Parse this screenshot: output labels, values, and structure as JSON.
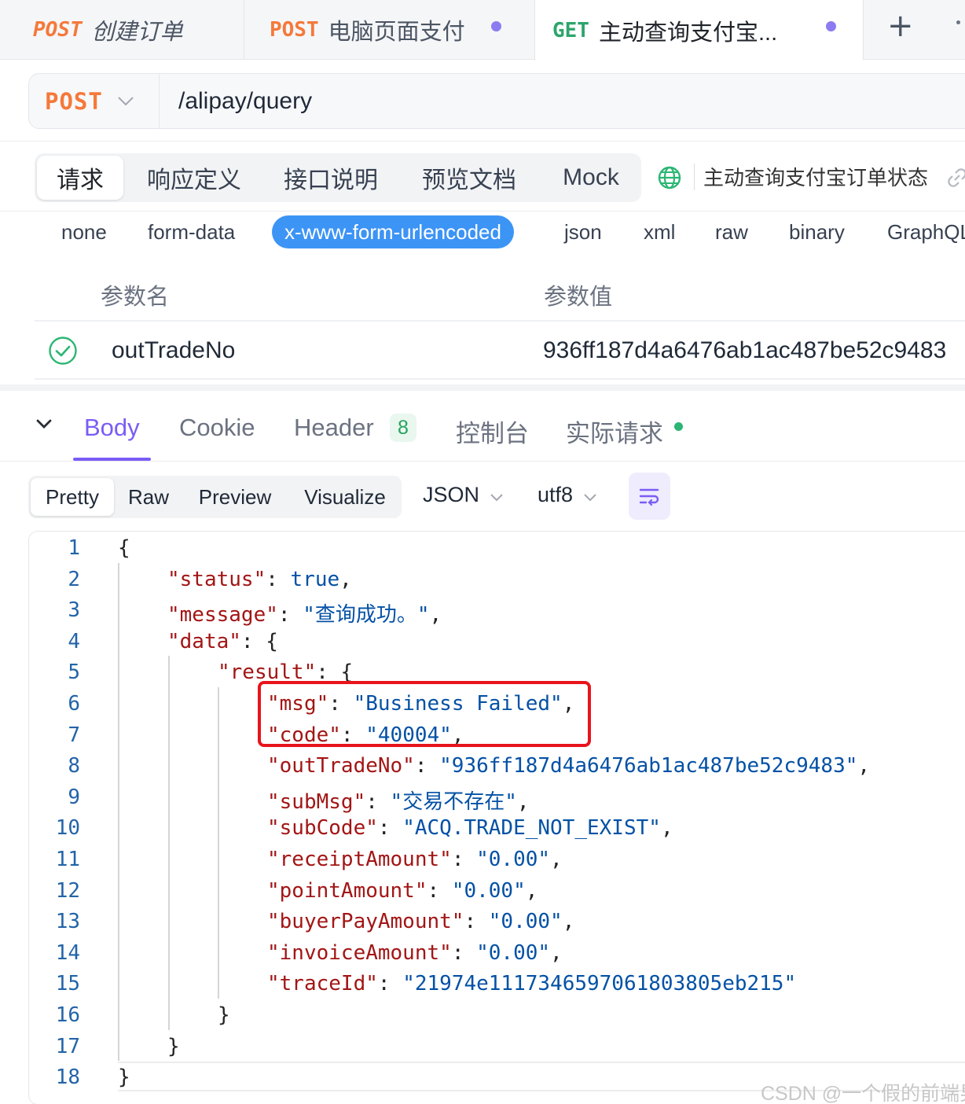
{
  "tabs": [
    {
      "method": "POST",
      "title": "创建订单"
    },
    {
      "method": "POST",
      "title": "电脑页面支付"
    },
    {
      "method": "GET",
      "title": "主动查询支付宝..."
    }
  ],
  "new_tab_label": "+",
  "request": {
    "method": "POST",
    "url": "/alipay/query",
    "tabs": [
      "请求",
      "响应定义",
      "接口说明",
      "预览文档",
      "Mock"
    ],
    "api_name": "主动查询支付宝订单状态"
  },
  "body_types": [
    "none",
    "form-data",
    "x-www-form-urlencoded",
    "json",
    "xml",
    "raw",
    "binary",
    "GraphQL"
  ],
  "params": {
    "headers": [
      "参数名",
      "参数值"
    ],
    "rows": [
      {
        "name": "outTradeNo",
        "value": "936ff187d4a6476ab1ac487be52c9483"
      }
    ]
  },
  "response": {
    "tabs": [
      "Body",
      "Cookie",
      "Header",
      "控制台",
      "实际请求"
    ],
    "header_count": "8",
    "formats": [
      "Pretty",
      "Raw",
      "Preview",
      "Visualize"
    ],
    "lang": "JSON",
    "encoding": "utf8"
  },
  "code_line_numbers": [
    "1",
    "2",
    "3",
    "4",
    "5",
    "6",
    "7",
    "8",
    "9",
    "10",
    "11",
    "12",
    "13",
    "14",
    "15",
    "16",
    "17",
    "18"
  ],
  "code": {
    "status_val": "true",
    "message_val": "\"查询成功。\"",
    "msg_val": "\"Business Failed\"",
    "code_val": "\"40004\"",
    "outTradeNo_val": "\"936ff187d4a6476ab1ac487be52c9483\"",
    "subMsg_val": "\"交易不存在\"",
    "subCode_val": "\"ACQ.TRADE_NOT_EXIST\"",
    "receiptAmount_val": "\"0.00\"",
    "pointAmount_val": "\"0.00\"",
    "buyerPayAmount_val": "\"0.00\"",
    "invoiceAmount_val": "\"0.00\"",
    "traceId_val": "\"21974e1117346597061803805eb215\""
  },
  "watermark": "CSDN @一个假的前端男",
  "colors": {
    "post": "#f5793a",
    "get": "#2ca56b",
    "accent": "#7b5cf5",
    "urlencoded_active": "#3c94f5",
    "highlight_box": "#e8141b"
  }
}
